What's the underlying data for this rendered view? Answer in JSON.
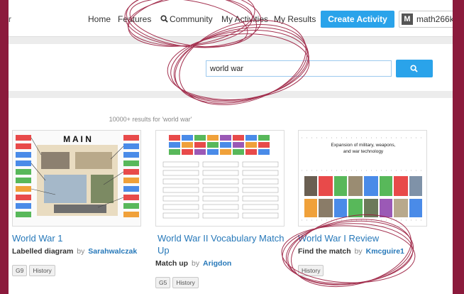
{
  "nav": {
    "fragment": "r",
    "home": "Home",
    "features": "Features",
    "community": "Community",
    "my_activities": "My Activities",
    "my_results": "My Results",
    "create_activity": "Create Activity",
    "user_initial": "M",
    "username": "math266k"
  },
  "search": {
    "value": "world war"
  },
  "results": {
    "count_text": "10000+ results for 'world war'",
    "by_text": "by",
    "items": [
      {
        "title": "World War 1",
        "type": "Labelled diagram",
        "author": "Sarahwalczak",
        "tags": [
          "G9",
          "History"
        ],
        "thumb_word": "M A I N"
      },
      {
        "title": "World War II Vocabulary Match Up",
        "type": "Match up",
        "author": "Arigdon",
        "tags": [
          "G5",
          "History"
        ]
      },
      {
        "title": "World War I Review",
        "type": "Find the match",
        "author": "Kmcguire1",
        "tags": [
          "History"
        ],
        "thumb_heading": "Expansion of military, weapons, and war technology"
      }
    ]
  },
  "colors": {
    "accent": "#2aa3ea",
    "link": "#2678b9",
    "frame": "#8b1a3c",
    "annotation": "#9a1b3d"
  }
}
